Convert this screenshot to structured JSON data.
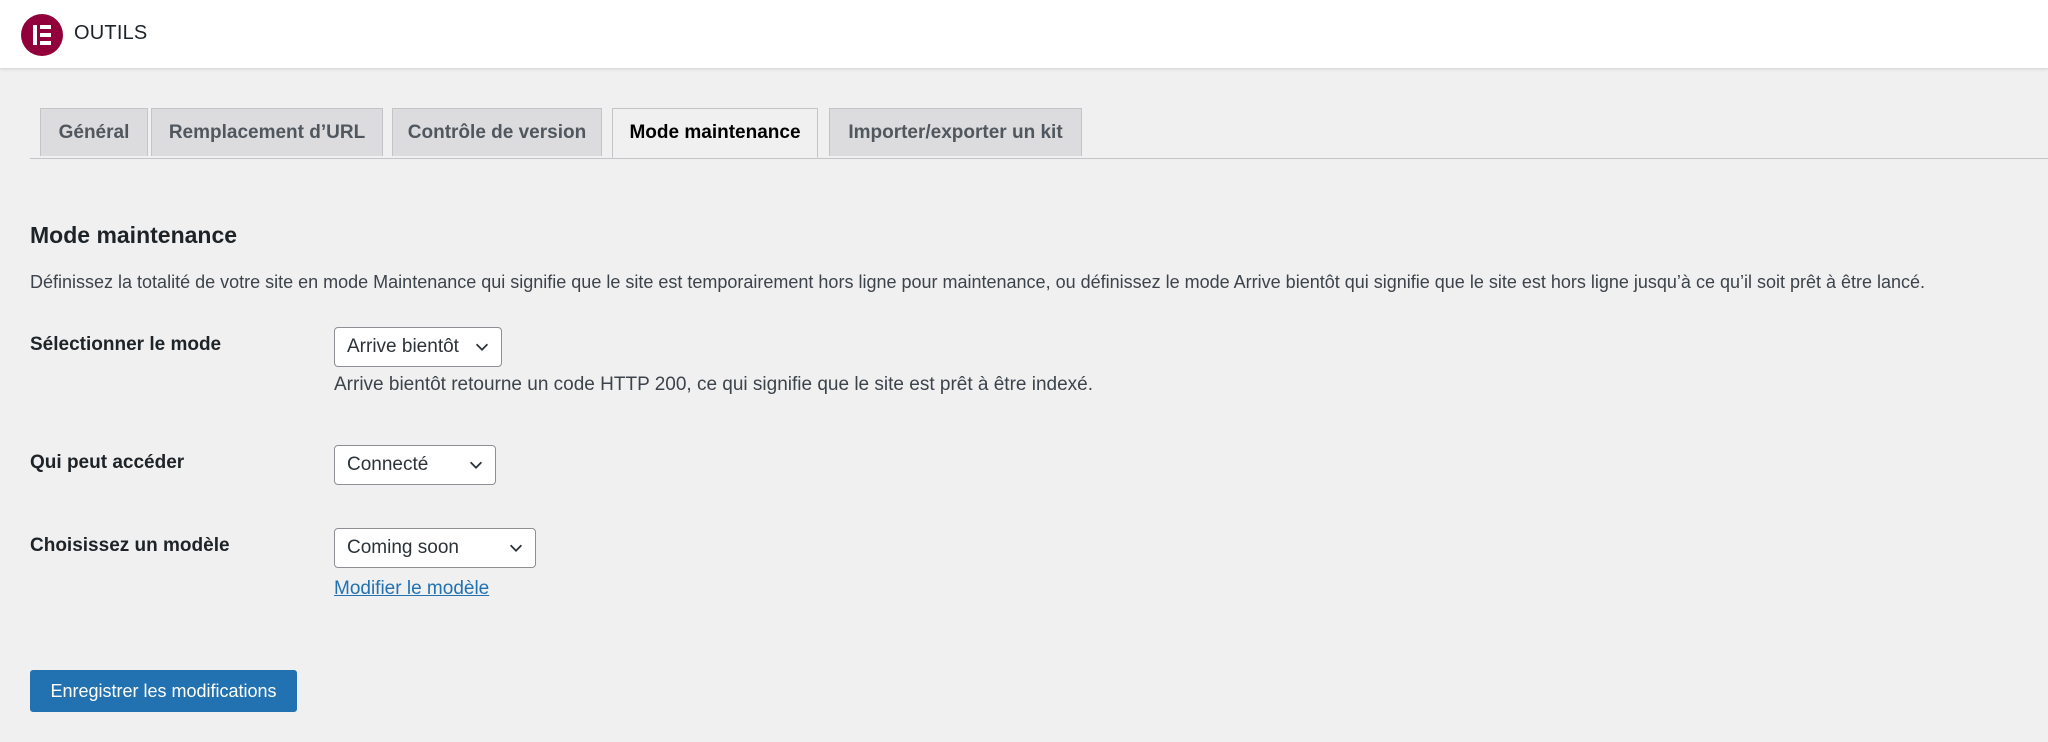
{
  "header": {
    "title": "OUTILS",
    "logo_color": "#92003b"
  },
  "tabs": [
    {
      "label": "Général",
      "active": false
    },
    {
      "label": "Remplacement d’URL",
      "active": false
    },
    {
      "label": "Contrôle de version",
      "active": false
    },
    {
      "label": "Mode maintenance",
      "active": true
    },
    {
      "label": "Importer/exporter un kit",
      "active": false
    }
  ],
  "section": {
    "title": "Mode maintenance",
    "description": "Définissez la totalité de votre site en mode Maintenance qui signifie que le site est temporairement hors ligne pour maintenance, ou définissez le mode Arrive bientôt qui signifie que le site est hors ligne jusqu’à ce qu’il soit prêt à être lancé."
  },
  "fields": {
    "mode": {
      "label": "Sélectionner le mode",
      "value": "Arrive bientôt",
      "help": "Arrive bientôt retourne un code HTTP 200, ce qui signifie que le site est prêt à être indexé."
    },
    "access": {
      "label": "Qui peut accéder",
      "value": "Connecté"
    },
    "template": {
      "label": "Choisissez un modèle",
      "value": "Coming soon",
      "edit_link": "Modifier le modèle"
    }
  },
  "actions": {
    "save_label": "Enregistrer les modifications",
    "primary_color": "#2271b1"
  }
}
